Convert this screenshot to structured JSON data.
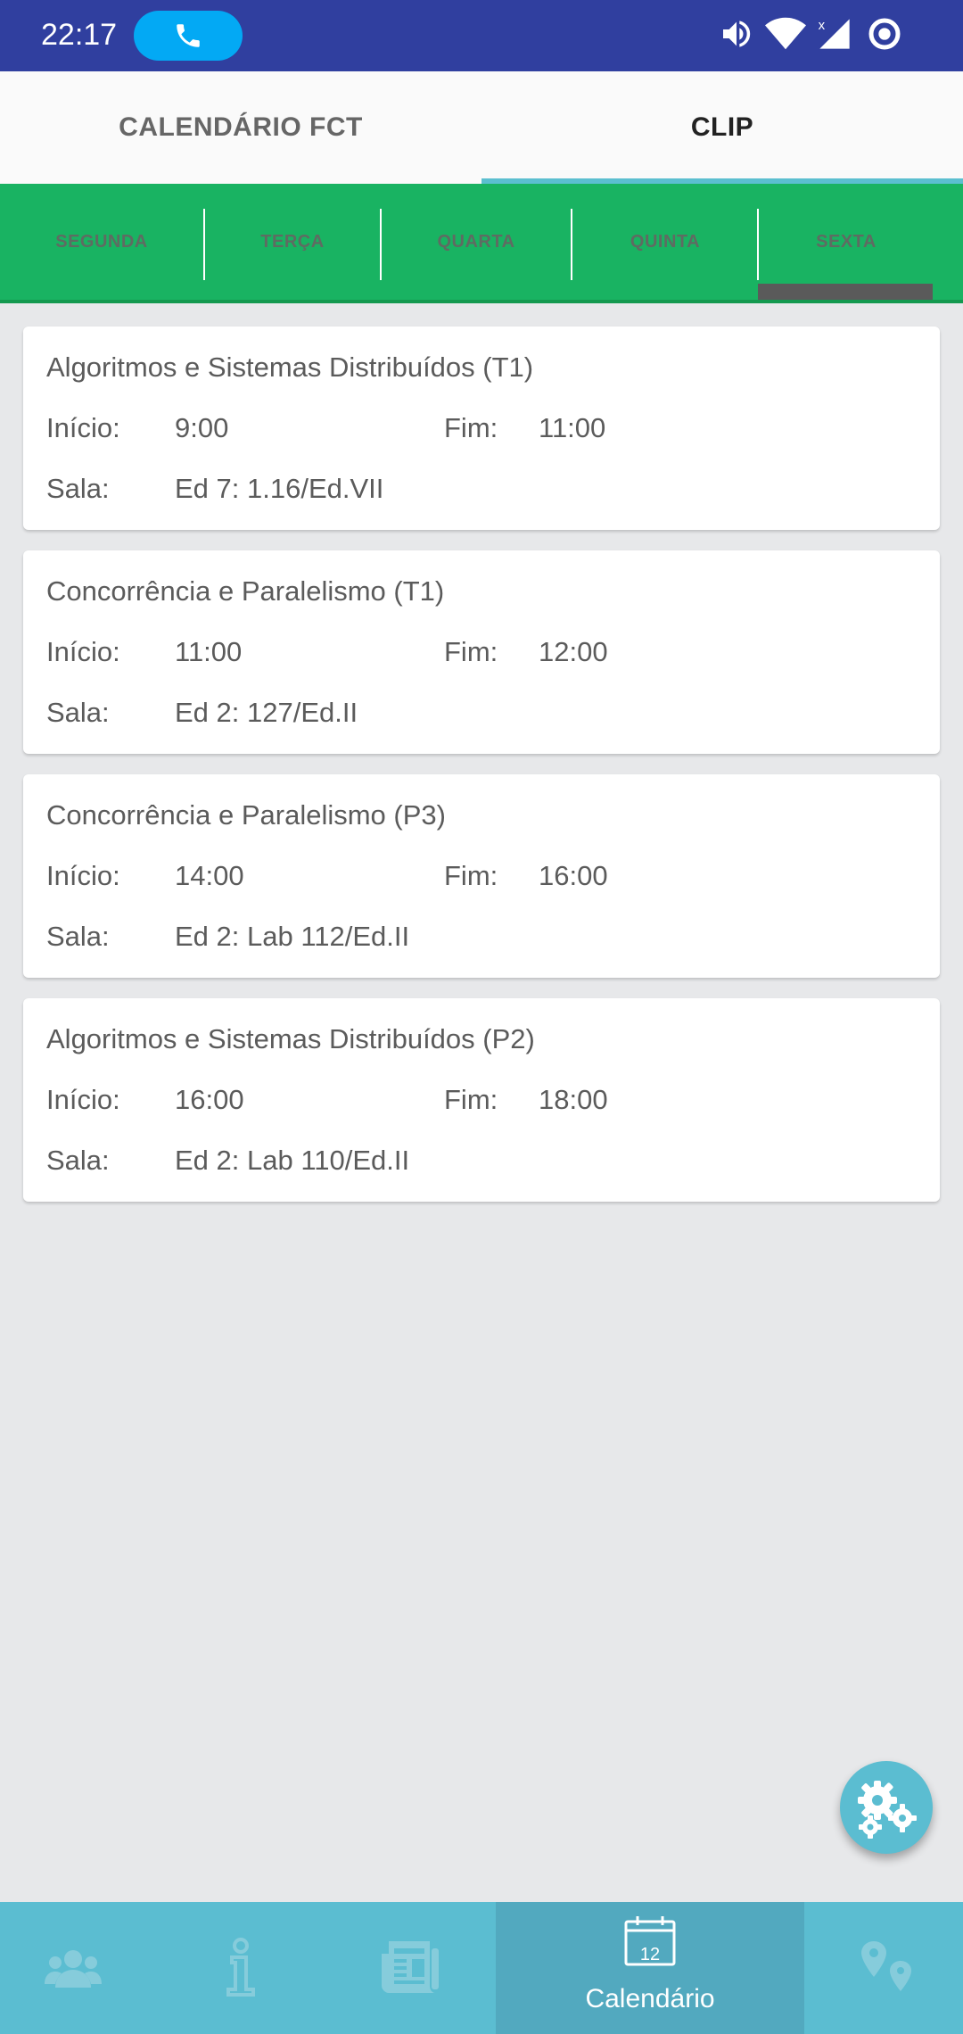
{
  "status_bar": {
    "time": "22:17",
    "icons": [
      "phone-call-icon",
      "volume-icon",
      "wifi-icon",
      "signal-icon",
      "sync-icon"
    ]
  },
  "top_tabs": [
    {
      "label": "CALENDÁRIO FCT",
      "active": false
    },
    {
      "label": "CLIP",
      "active": true
    }
  ],
  "day_tabs": [
    {
      "label": "SEGUNDA",
      "active": false
    },
    {
      "label": "TERÇA",
      "active": false
    },
    {
      "label": "QUARTA",
      "active": false
    },
    {
      "label": "QUINTA",
      "active": false
    },
    {
      "label": "SEXTA",
      "active": true
    }
  ],
  "labels": {
    "start": "Início:",
    "end": "Fim:",
    "room": "Sala:"
  },
  "classes": [
    {
      "title": "Algoritmos e Sistemas Distribuídos (T1)",
      "start": "9:00",
      "end": "11:00",
      "room": "Ed 7: 1.16/Ed.VII"
    },
    {
      "title": "Concorrência e Paralelismo (T1)",
      "start": "11:00",
      "end": "12:00",
      "room": "Ed 2: 127/Ed.II"
    },
    {
      "title": "Concorrência e Paralelismo (P3)",
      "start": "14:00",
      "end": "16:00",
      "room": "Ed 2: Lab 112/Ed.II"
    },
    {
      "title": "Algoritmos e Sistemas Distribuídos (P2)",
      "start": "16:00",
      "end": "18:00",
      "room": "Ed 2: Lab 110/Ed.II"
    }
  ],
  "fab": {
    "icon": "gears-icon"
  },
  "bottom_nav": {
    "items": [
      {
        "icon": "people-icon",
        "label": ""
      },
      {
        "icon": "info-icon",
        "label": ""
      },
      {
        "icon": "news-icon",
        "label": ""
      },
      {
        "icon": "calendar-icon",
        "label": "Calendário",
        "calendar_day": "12",
        "active": true
      },
      {
        "icon": "map-pins-icon",
        "label": ""
      }
    ]
  },
  "colors": {
    "status_bar": "#303f9f",
    "day_tabs": "#19b362",
    "accent": "#5bbdd1",
    "tab_indicator": "#5bbfd0"
  }
}
